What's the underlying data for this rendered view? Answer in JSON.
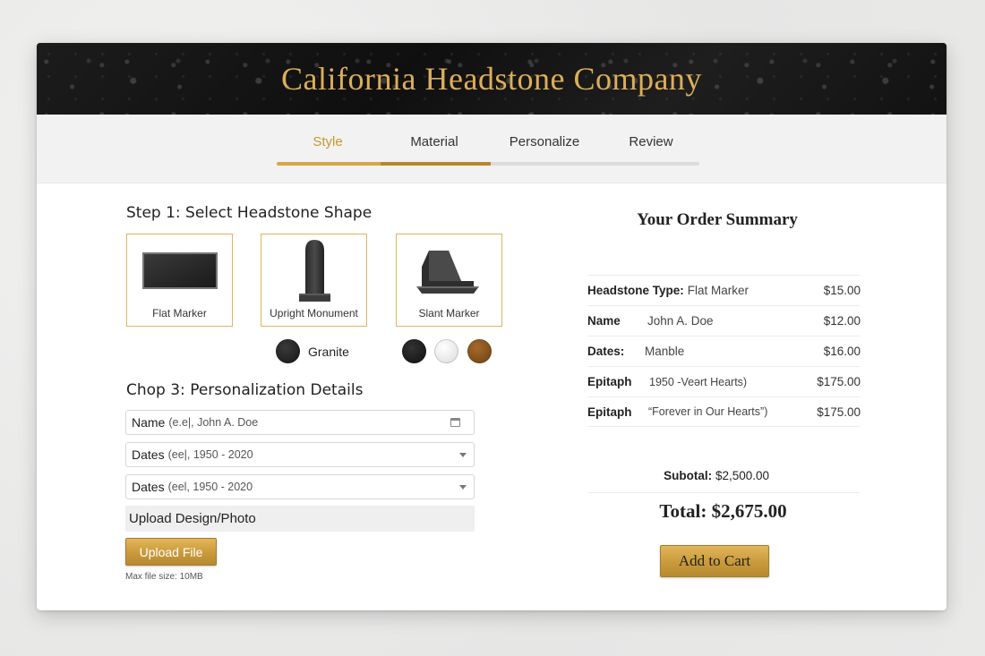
{
  "header": {
    "brand": "California Headstone Company"
  },
  "stepper": {
    "tabs": [
      {
        "label": "Style",
        "active": true
      },
      {
        "label": "Material",
        "active": false
      },
      {
        "label": "Personalize",
        "active": false
      },
      {
        "label": "Review",
        "active": false
      }
    ]
  },
  "step1": {
    "heading": "Step 1: Select Headstone Shape",
    "shapes": [
      {
        "label": "Flat Marker"
      },
      {
        "label": "Upright Monument"
      },
      {
        "label": "Slant Marker"
      }
    ],
    "material_label": "Granite"
  },
  "step3": {
    "heading": "Chop 3: Personalization Details",
    "fields": [
      {
        "label": "Name",
        "placeholder": "(e.e|, John A. Doe"
      },
      {
        "label": "Dates",
        "placeholder": "(ee|, 1950 - 2020"
      },
      {
        "label": "Dates",
        "placeholder": "(eel, 1950 - 2020"
      }
    ],
    "upload_heading": "Upload Design/Photo",
    "upload_button": "Upload File",
    "upload_hint": "Max file size: 10MB"
  },
  "summary": {
    "title": "Your Order Summary",
    "rows": [
      {
        "key": "Headstone Type:",
        "value": "Flat Marker",
        "price": "$15.00"
      },
      {
        "key": "Name",
        "value": "John A. Doe",
        "price": "$12.00"
      },
      {
        "key": "Dates:",
        "value": "Manble",
        "price": "$16.00"
      },
      {
        "key": "Epitaph",
        "value": "1950 -Veərt Hearts)",
        "price": "$175.00"
      },
      {
        "key": "Epitaph",
        "value": "“Forever in Our Hearts”)",
        "price": "$175.00"
      }
    ],
    "subtotal_label": "Subotal:",
    "subtotal_value": "$2,500.00",
    "total_label": "Total: $2,675.00",
    "add_to_cart": "Add to Cart"
  },
  "colors": {
    "accent_gold": "#dcae5a",
    "button_gold": "#c99a3c",
    "header_bg": "#151515"
  }
}
